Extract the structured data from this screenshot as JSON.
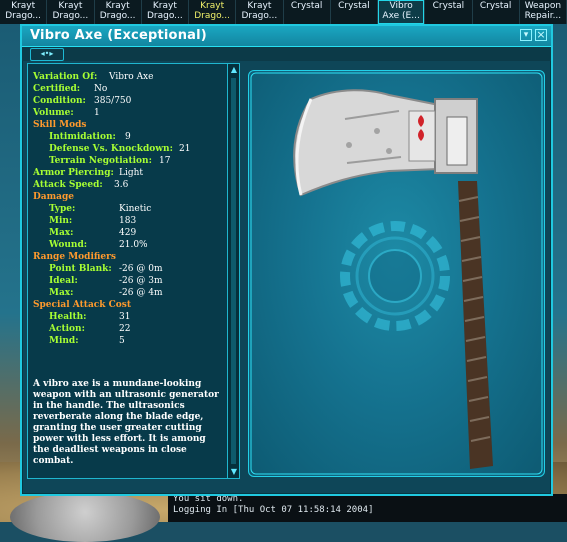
{
  "inventory": [
    {
      "line1": "Krayt",
      "line2": "Drago...",
      "style": "normal"
    },
    {
      "line1": "Krayt",
      "line2": "Drago...",
      "style": "normal"
    },
    {
      "line1": "Krayt",
      "line2": "Drago...",
      "style": "normal"
    },
    {
      "line1": "Krayt",
      "line2": "Drago...",
      "style": "normal"
    },
    {
      "line1": "Krayt",
      "line2": "Drago...",
      "style": "hi"
    },
    {
      "line1": "Krayt",
      "line2": "Drago...",
      "style": "normal"
    },
    {
      "line1": "",
      "line2": "Crystal",
      "style": "normal"
    },
    {
      "line1": "",
      "line2": "Crystal",
      "style": "normal"
    },
    {
      "line1": "Vibro",
      "line2": "Axe (E...",
      "style": "sel"
    },
    {
      "line1": "",
      "line2": "Crystal",
      "style": "normal"
    },
    {
      "line1": "",
      "line2": "Crystal",
      "style": "normal"
    },
    {
      "line1": "Weapon",
      "line2": "Repair...",
      "style": "normal"
    }
  ],
  "window": {
    "title": "Vibro Axe (Exceptional)",
    "close_glyph": "×",
    "min_glyph": "▾",
    "nav_glyph": "◂•▸"
  },
  "details": {
    "variation_label": "Variation Of:",
    "variation_value": "Vibro Axe",
    "certified_label": "Certified:",
    "certified_value": "No",
    "condition_label": "Condition:",
    "condition_value": "385/750",
    "volume_label": "Volume:",
    "volume_value": "1",
    "skill_mods_label": "Skill Mods",
    "intimidation_label": "Intimidation:",
    "intimidation_value": "9",
    "defense_label": "Defense Vs. Knockdown:",
    "defense_value": "21",
    "terrain_label": "Terrain Negotiation:",
    "terrain_value": "17",
    "armor_label": "Armor Piercing:",
    "armor_value": "Light",
    "attack_speed_label": "Attack Speed:",
    "attack_speed_value": "3.6",
    "damage_label": "Damage",
    "type_label": "Type:",
    "type_value": "Kinetic",
    "min_label": "Min:",
    "min_value": "183",
    "max_label": "Max:",
    "max_value": "429",
    "wound_label": "Wound:",
    "wound_value": "21.0%",
    "range_label": "Range Modifiers",
    "point_blank_label": "Point Blank:",
    "point_blank_value": "-26 @  0m",
    "ideal_label": "Ideal:",
    "ideal_value": "-26 @  3m",
    "range_max_label": "Max:",
    "range_max_value": "-26 @  4m",
    "special_label": "Special Attack Cost",
    "health_label": "Health:",
    "health_value": "31",
    "action_label": "Action:",
    "action_value": "22",
    "mind_label": "Mind:",
    "mind_value": "5",
    "description": "A vibro axe is a mundane-looking weapon with an ultrasonic generator in the handle. The ultrasonics reverberate along the blade edge, granting the user greater cutting power with less effort. It is among the deadliest weapons in close combat."
  },
  "chat": {
    "line1": "You sit down.",
    "line2": "Logging In [Thu Oct 07 11:58:14 2004]"
  },
  "colors": {
    "accent": "#20c9e0",
    "label_green": "#a7ff33",
    "section_orange": "#ff9a2d"
  }
}
